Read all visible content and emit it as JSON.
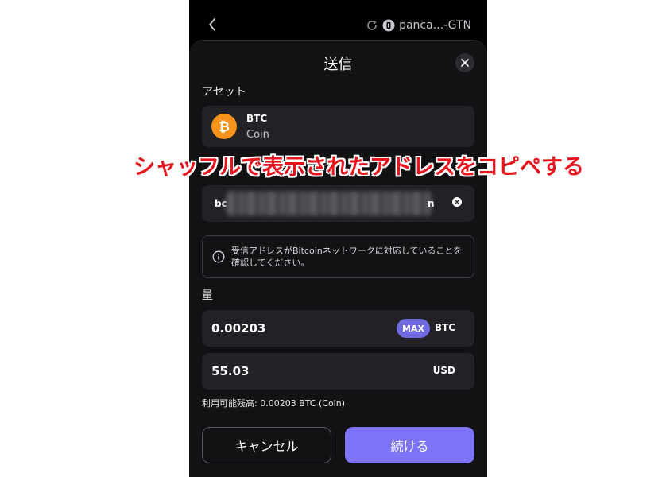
{
  "topbar": {
    "account_label": "panca...-GTN"
  },
  "sheet": {
    "title": "送信"
  },
  "asset": {
    "section_label": "アセット",
    "symbol": "BTC",
    "name": "Coin"
  },
  "address": {
    "visible_text": "bc",
    "visible_tail": "n"
  },
  "notice": {
    "text": "受信アドレスがBitcoinネットワークに対応していることを確認してください。"
  },
  "amount": {
    "section_label": "量",
    "crypto_value": "0.00203",
    "max_label": "MAX",
    "crypto_unit": "BTC",
    "fiat_value": "55.03",
    "fiat_unit": "USD"
  },
  "balance": {
    "text": "利用可能残高: 0.00203 BTC (Coin)"
  },
  "buttons": {
    "cancel": "キャンセル",
    "continue": "続ける"
  },
  "annotation": {
    "text": "シャッフルで表示されたアドレスをコピペする"
  },
  "colors": {
    "accent": "#7c74f4",
    "bitcoin": "#f7931a",
    "annotation": "#e8141d"
  }
}
